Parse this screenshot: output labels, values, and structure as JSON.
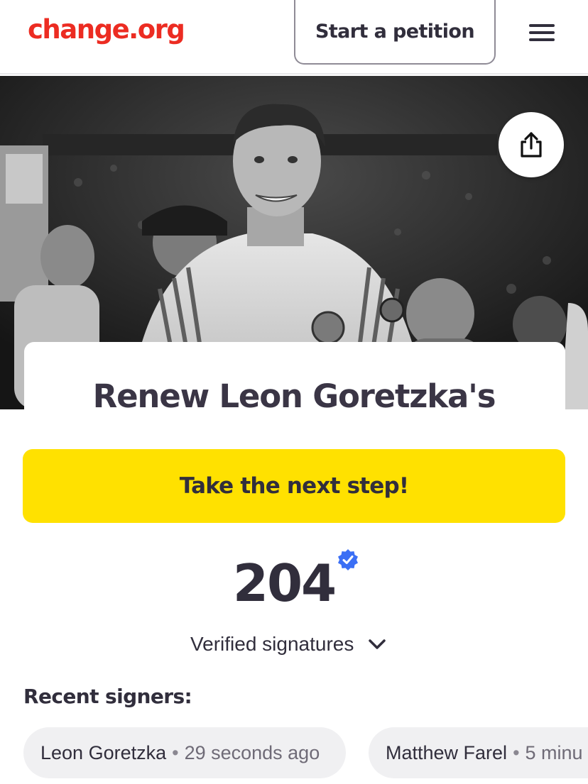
{
  "header": {
    "logo": "change.org",
    "start_button": "Start a petition",
    "menu_icon": "hamburger-menu-icon"
  },
  "hero": {
    "photo_description_icon": "petition-hero-photo",
    "share_icon": "share-icon"
  },
  "petition": {
    "title": "Renew Leon Goretzka's"
  },
  "cta": {
    "label": "Take the next step!",
    "color": "#ffe100"
  },
  "signatures": {
    "count": "204",
    "label": "Verified signatures",
    "badge_icon": "verified-check-icon",
    "badge_color": "#3b6ff5",
    "toggle_icon": "chevron-down-icon"
  },
  "recent": {
    "title": "Recent signers:",
    "signers": [
      {
        "name": "Leon Goretzka",
        "time": "29 seconds ago"
      },
      {
        "name": "Matthew Farel",
        "time": "5 minu"
      }
    ]
  },
  "colors": {
    "brand": "#ec2c22",
    "text": "#312e3c"
  }
}
